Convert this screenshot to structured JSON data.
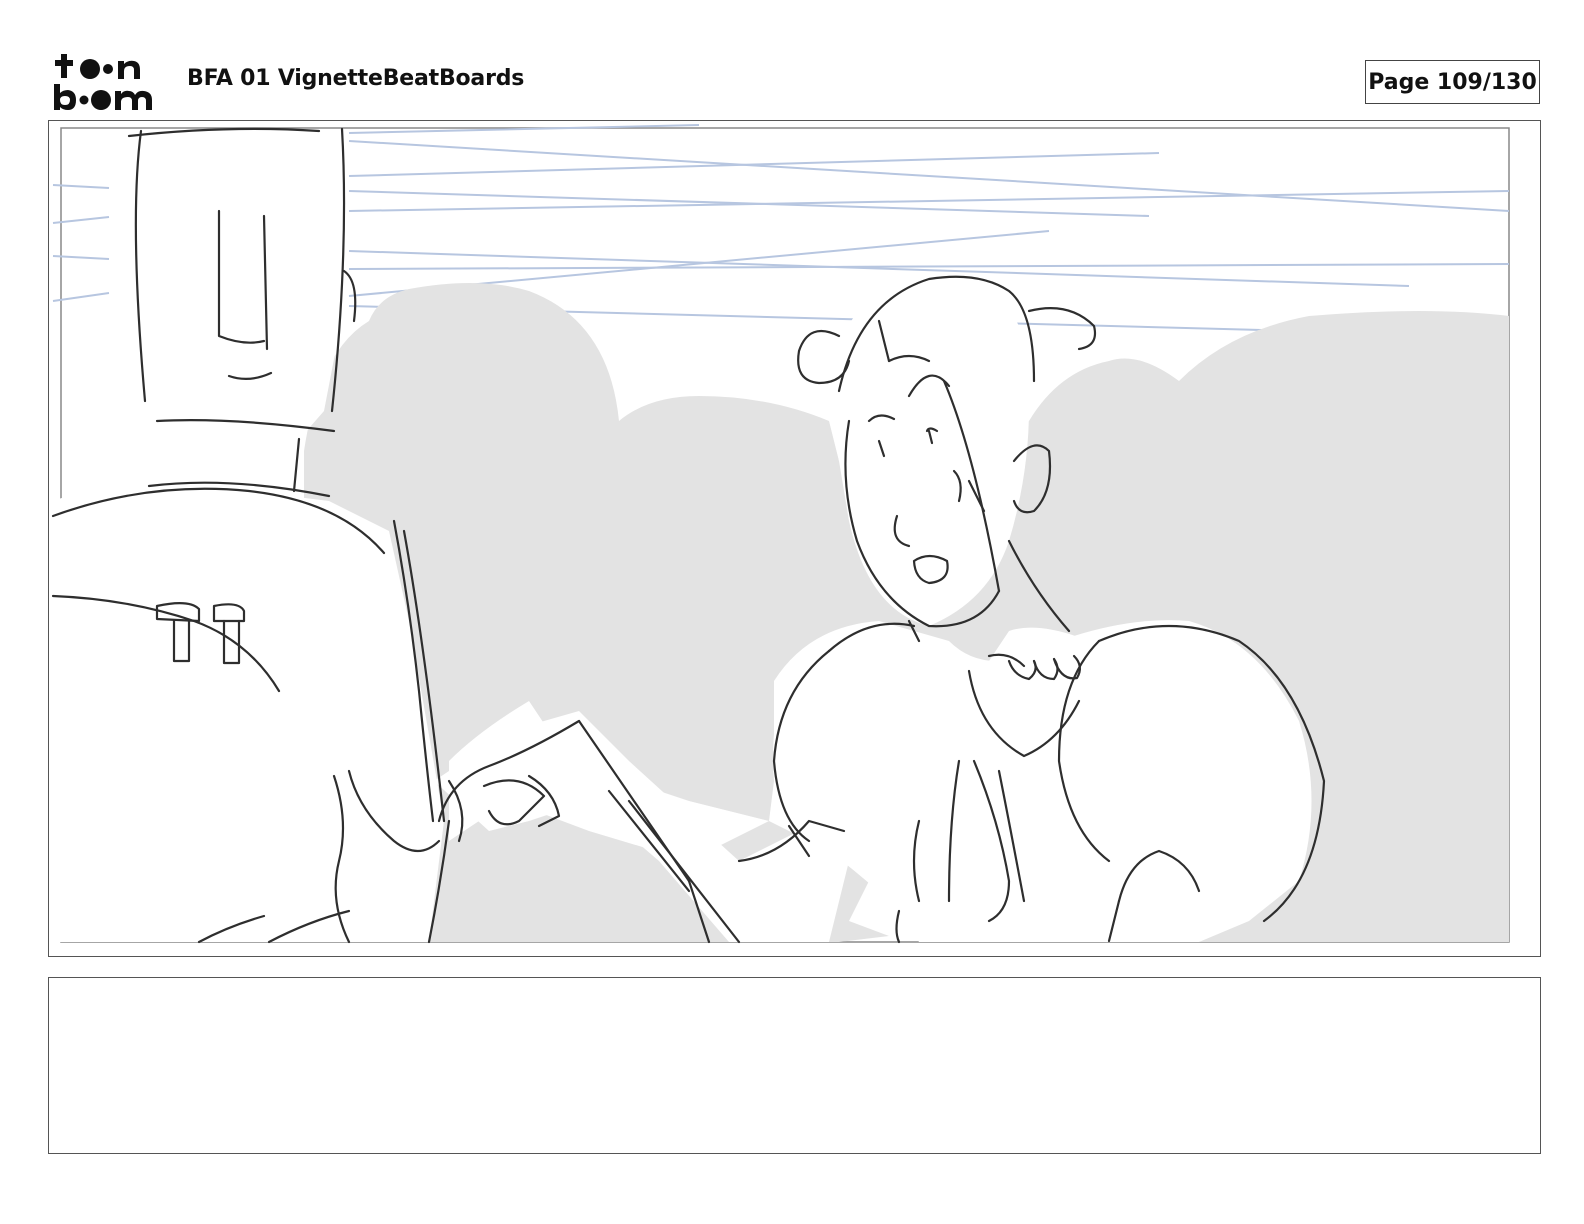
{
  "header": {
    "logo_text": "toon boom",
    "title": "BFA 01 VignetteBeatBoards",
    "page": "Page 109/130"
  },
  "panel": {
    "image_icon": "storyboard-sketch-image"
  },
  "caption": {
    "text": ""
  }
}
